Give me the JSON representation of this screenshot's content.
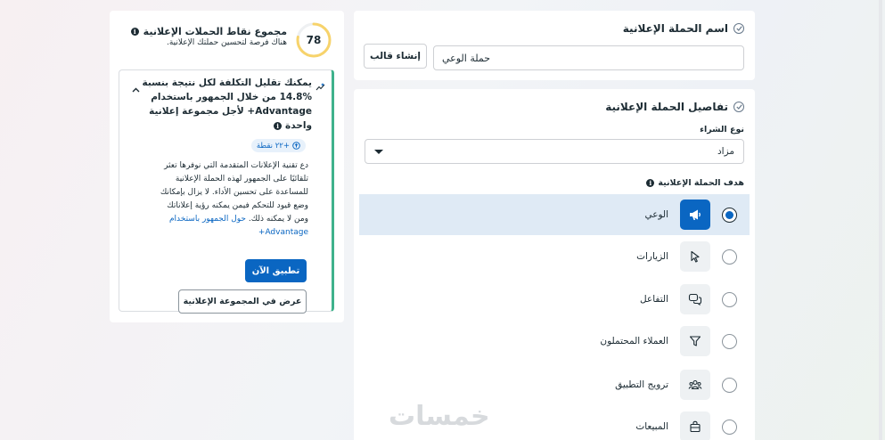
{
  "campaign_name_section": {
    "title": "اسم الحملة الإعلانية",
    "name_value": "حملة الوعي",
    "create_template_label": "إنشاء قالب"
  },
  "campaign_details": {
    "title": "تفاصيل الحملة الإعلانية",
    "buy_type_label": "نوع الشراء",
    "buy_type_value": "مزاد",
    "objective_label": "هدف الحملة الإعلانية",
    "objectives": [
      {
        "label": "الوعي",
        "icon": "megaphone-icon",
        "selected": true
      },
      {
        "label": "الزيارات",
        "icon": "cursor-icon",
        "selected": false
      },
      {
        "label": "التفاعل",
        "icon": "chat-bubbles-icon",
        "selected": false
      },
      {
        "label": "العملاء المحتملون",
        "icon": "funnel-icon",
        "selected": false
      },
      {
        "label": "ترويج التطبيق",
        "icon": "people-icon",
        "selected": false
      },
      {
        "label": "المبيعات",
        "icon": "shopping-bag-icon",
        "selected": false
      }
    ]
  },
  "score_card": {
    "score": "78",
    "score_fraction": 0.78,
    "title": "مجموع نقاط الحملات الإعلانية",
    "subtitle": "هناك فرصة لتحسين حملتك الإعلانية.",
    "recommendation": {
      "title_lines": [
        "يمكنك تقليل التكلفة لكل نتيجة بنسبة",
        "14.8% من خلال الجمهور باستخدام",
        "Advantage+ لأجل مجموعة إعلانية",
        "واحدة"
      ],
      "points_badge": "+٢٢ نقطة",
      "description_lines": [
        "دع تقنية الإعلانات المتقدمة التي نوفرها تعثر",
        "تلقائيًا على الجمهور لهذه الحملة الإعلانية",
        "للمساعدة على تحسين الأداء. لا يزال بإمكانك",
        "وضع قيود للتحكم فيمن يمكنه رؤية إعلاناتك",
        "ومن لا يمكنه ذلك."
      ],
      "link_text_1": "حول الجمهور باستخدام",
      "link_text_2": "Advantage+",
      "apply_label": "تطبيق الآن",
      "view_label": "عرض في المجموعة الإعلانية"
    }
  },
  "watermark": "خمسات",
  "colors": {
    "accent": "#0a66c2",
    "selected_row": "#dfeaf5",
    "score_ring": "#f7d36b",
    "rec_border": "#3fb28c"
  }
}
